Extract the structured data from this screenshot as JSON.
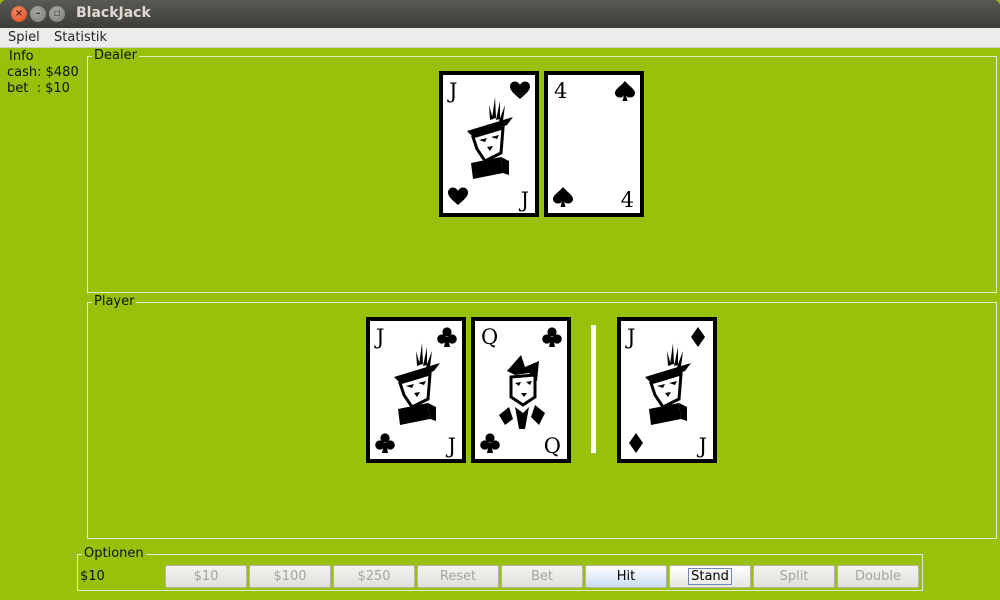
{
  "window": {
    "title": "BlackJack"
  },
  "menu": {
    "items": [
      "Spiel",
      "Statistik"
    ]
  },
  "info": {
    "title": "Info",
    "cash": "cash: $480",
    "bet": "bet  : $10"
  },
  "dealer": {
    "title": "Dealer",
    "cards": [
      {
        "rank": "J",
        "suit": "hearts"
      },
      {
        "rank": "4",
        "suit": "spades"
      }
    ]
  },
  "player": {
    "title": "Player",
    "hands": [
      [
        {
          "rank": "J",
          "suit": "clubs"
        },
        {
          "rank": "Q",
          "suit": "clubs"
        }
      ],
      [
        {
          "rank": "J",
          "suit": "diamonds"
        }
      ]
    ]
  },
  "options": {
    "title": "Optionen",
    "amount": "$10",
    "buttons": [
      {
        "label": "$10",
        "enabled": false
      },
      {
        "label": "$100",
        "enabled": false
      },
      {
        "label": "$250",
        "enabled": false
      },
      {
        "label": "Reset",
        "enabled": false
      },
      {
        "label": "Bet",
        "enabled": false
      },
      {
        "label": "Hit",
        "enabled": true
      },
      {
        "label": "Stand",
        "enabled": true
      },
      {
        "label": "Split",
        "enabled": false
      },
      {
        "label": "Double",
        "enabled": false
      }
    ]
  },
  "colors": {
    "table": "#97c10a",
    "panel_border": "#e4ecc8"
  }
}
